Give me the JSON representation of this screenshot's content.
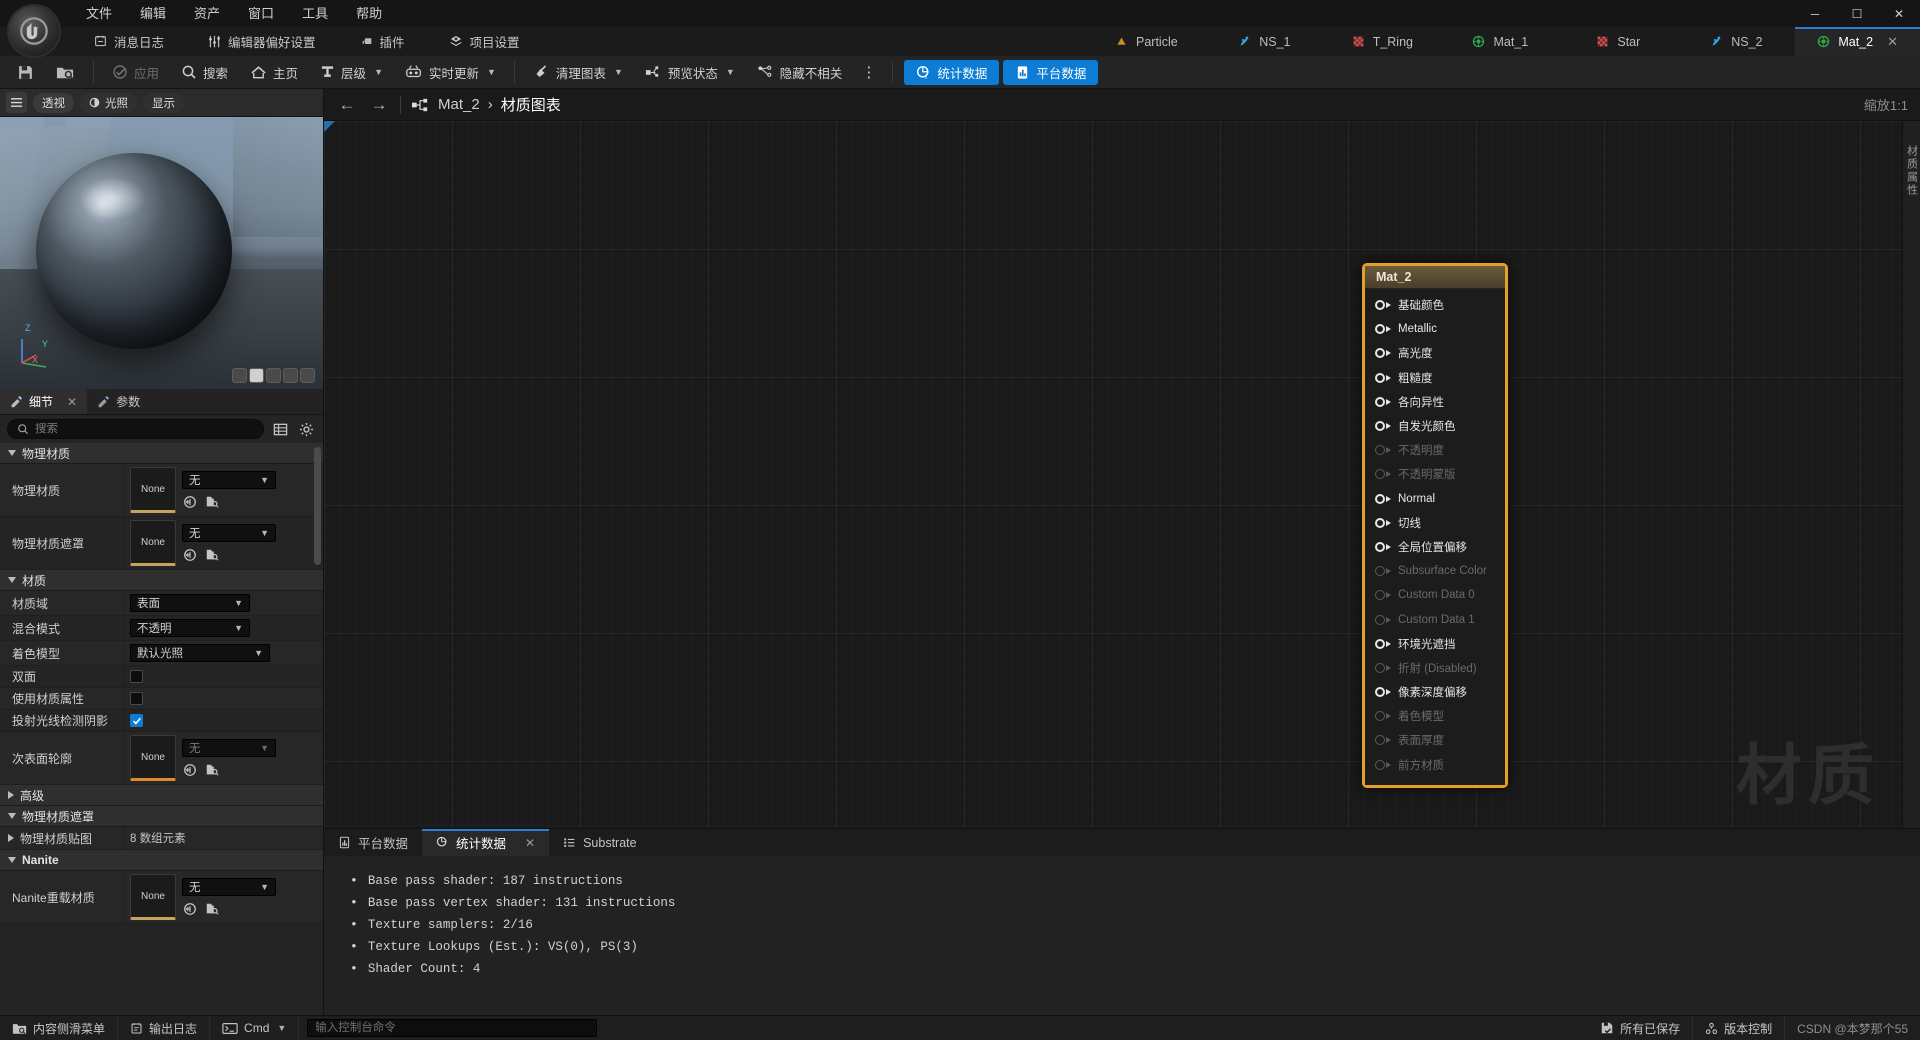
{
  "window": {
    "minimize_label": "─",
    "maximize_label": "☐",
    "close_label": "✕"
  },
  "menu": {
    "items": [
      {
        "label": "文件"
      },
      {
        "label": "编辑"
      },
      {
        "label": "资产"
      },
      {
        "label": "窗口"
      },
      {
        "label": "工具"
      },
      {
        "label": "帮助"
      }
    ]
  },
  "quickbar": {
    "items": [
      {
        "label": "消息日志",
        "icon": "message-log-icon"
      },
      {
        "label": "编辑器偏好设置",
        "icon": "sliders-icon"
      },
      {
        "label": "插件",
        "icon": "plugin-icon"
      },
      {
        "label": "项目设置",
        "icon": "project-settings-icon"
      }
    ]
  },
  "tabs": [
    {
      "label": "Particle",
      "icon": "particle-icon",
      "active": false,
      "color": "#d08a2a"
    },
    {
      "label": "NS_1",
      "icon": "niagara-icon",
      "active": false,
      "color": "#2ba9e0"
    },
    {
      "label": "T_Ring",
      "icon": "texture-icon",
      "active": false,
      "color": "#b83f3f"
    },
    {
      "label": "Mat_1",
      "icon": "material-icon",
      "active": false,
      "color": "#2faa4a"
    },
    {
      "label": "Star",
      "icon": "texture-icon",
      "active": false,
      "color": "#b83f3f"
    },
    {
      "label": "NS_2",
      "icon": "niagara-icon",
      "active": false,
      "color": "#2ba9e0"
    },
    {
      "label": "Mat_2",
      "icon": "material-icon",
      "active": true,
      "color": "#2faa4a",
      "close_label": "✕"
    }
  ],
  "toolbar": {
    "save_label": "save-icon",
    "browse_label": "browse-icon",
    "apply_label": "应用",
    "search_label": "搜索",
    "home_label": "主页",
    "hierarchy_label": "层级",
    "live_update_label": "实时更新",
    "clean_graph_label": "清理图表",
    "preview_state_label": "预览状态",
    "hide_unrelated_label": "隐藏不相关",
    "overflow_label": "⋮",
    "stats_label": "统计数据",
    "platform_stats_label": "平台数据",
    "accent_blue": "#0c7cd5"
  },
  "viewport": {
    "menu_icon": "viewport-menu-icon",
    "perspective_label": "透视",
    "lit_label": "光照",
    "show_label": "显示",
    "axis_x": "X",
    "axis_y": "Y",
    "axis_z": "Z"
  },
  "details": {
    "tabs": [
      {
        "label": "细节",
        "icon": "details-icon",
        "active": true,
        "close_label": "✕"
      },
      {
        "label": "参数",
        "icon": "params-icon",
        "active": false
      }
    ],
    "search_placeholder": "搜索",
    "search_value": "",
    "grid_icon": "grid-view-icon",
    "settings_icon": "gear-icon",
    "sections": [
      {
        "title": "物理材质",
        "expanded": true,
        "rows": [
          {
            "label": "物理材质",
            "type": "asset",
            "thumb": "None",
            "combo": "无"
          },
          {
            "label": "物理材质遮罩",
            "type": "asset",
            "thumb": "None",
            "combo": "无"
          }
        ]
      },
      {
        "title": "材质",
        "expanded": true,
        "rows": [
          {
            "label": "材质域",
            "type": "combo",
            "value": "表面"
          },
          {
            "label": "混合模式",
            "type": "combo",
            "value": "不透明"
          },
          {
            "label": "着色模型",
            "type": "combo-wide",
            "value": "默认光照"
          },
          {
            "label": "双面",
            "type": "checkbox",
            "checked": false
          },
          {
            "label": "使用材质属性",
            "type": "checkbox",
            "checked": false
          },
          {
            "label": "投射光线检测阴影",
            "type": "checkbox",
            "checked": true
          },
          {
            "label": "次表面轮廓",
            "type": "asset",
            "thumb": "None",
            "combo": "无"
          }
        ]
      },
      {
        "title": "高级",
        "expanded": false,
        "rows": []
      },
      {
        "title": "物理材质遮罩",
        "expanded": true,
        "rows": [
          {
            "label": "物理材质贴图",
            "type": "array",
            "value": "8 数组元素",
            "collapsed": true
          }
        ]
      },
      {
        "title": "Nanite",
        "expanded": true,
        "bold": true,
        "rows": [
          {
            "label": "Nanite重载材质",
            "type": "asset",
            "thumb": "None",
            "combo": "无"
          }
        ]
      }
    ]
  },
  "graph": {
    "back_label": "←",
    "forward_label": "→",
    "breadcrumb_icon": "graph-icon",
    "breadcrumb_asset": "Mat_2",
    "breadcrumb_sep": "›",
    "breadcrumb_page": "材质图表",
    "zoom_label": "缩放1:1",
    "rail_label": "材质属性",
    "watermark": "材质",
    "node": {
      "title": "Mat_2",
      "border_color": "#e2a12a",
      "pins": [
        {
          "label": "基础颜色",
          "enabled": true
        },
        {
          "label": "Metallic",
          "enabled": true
        },
        {
          "label": "高光度",
          "enabled": true
        },
        {
          "label": "粗糙度",
          "enabled": true
        },
        {
          "label": "各向异性",
          "enabled": true
        },
        {
          "label": "自发光颜色",
          "enabled": true
        },
        {
          "label": "不透明度",
          "enabled": false
        },
        {
          "label": "不透明蒙版",
          "enabled": false
        },
        {
          "label": "Normal",
          "enabled": true
        },
        {
          "label": "切线",
          "enabled": true
        },
        {
          "label": "全局位置偏移",
          "enabled": true
        },
        {
          "label": "Subsurface Color",
          "enabled": false
        },
        {
          "label": "Custom Data 0",
          "enabled": false
        },
        {
          "label": "Custom Data 1",
          "enabled": false
        },
        {
          "label": "环境光遮挡",
          "enabled": true
        },
        {
          "label": "折射 (Disabled)",
          "enabled": false
        },
        {
          "label": "像素深度偏移",
          "enabled": true
        },
        {
          "label": "着色模型",
          "enabled": false
        },
        {
          "label": "表面厚度",
          "enabled": false
        },
        {
          "label": "前方材质",
          "enabled": false
        }
      ]
    }
  },
  "dock": {
    "tabs": [
      {
        "label": "平台数据",
        "icon": "platform-stats-icon",
        "active": false
      },
      {
        "label": "统计数据",
        "icon": "stats-icon",
        "active": true,
        "close_label": "✕"
      },
      {
        "label": "Substrate",
        "icon": "substrate-icon",
        "active": false
      }
    ],
    "stats": [
      "Base pass shader: 187 instructions",
      "Base pass vertex shader: 131 instructions",
      "Texture samplers: 2/16",
      "Texture Lookups (Est.): VS(0), PS(3)",
      "Shader Count: 4"
    ]
  },
  "statusbar": {
    "content_drawer_label": "内容侧滑菜单",
    "output_log_label": "输出日志",
    "cmd_label": "Cmd",
    "console_placeholder": "输入控制台命令",
    "console_value": "",
    "all_saved_label": "所有已保存",
    "revision_label": "版本控制",
    "watermark": "CSDN @本梦那个55"
  }
}
